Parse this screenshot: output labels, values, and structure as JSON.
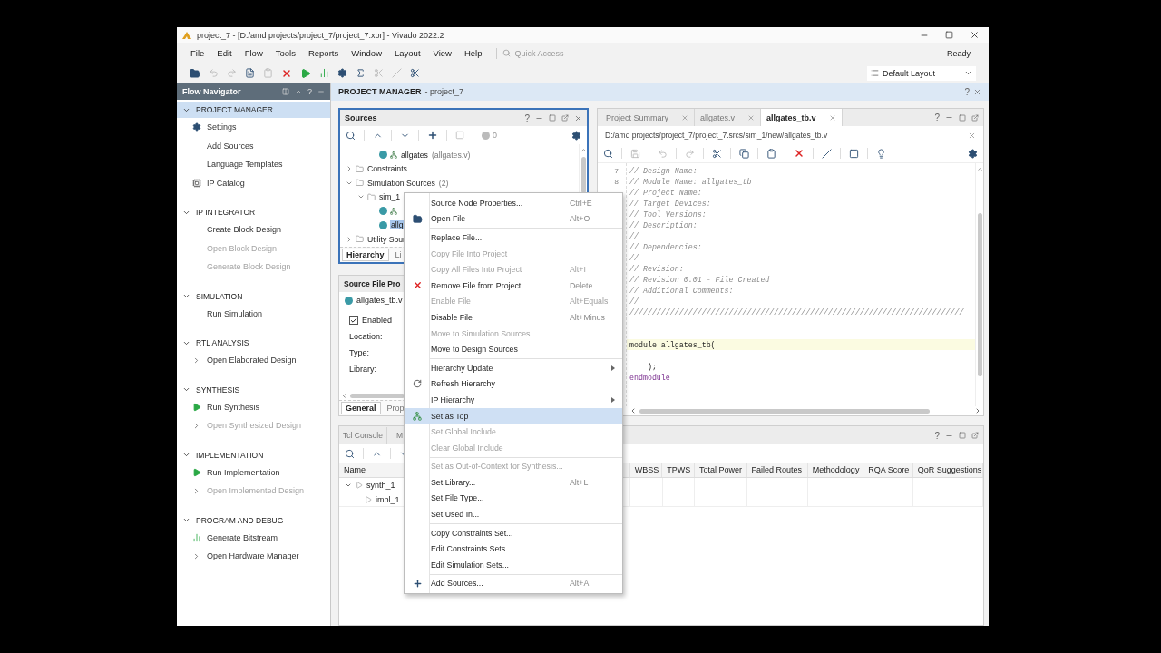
{
  "window": {
    "title": "project_7 - [D:/amd projects/project_7/project_7.xpr] - Vivado 2022.2"
  },
  "menu_bar": [
    "File",
    "Edit",
    "Flow",
    "Tools",
    "Reports",
    "Window",
    "Layout",
    "View",
    "Help"
  ],
  "quick_access": {
    "placeholder": "Quick Access"
  },
  "status": "Ready",
  "layout_select": {
    "value": "Default Layout"
  },
  "flow_navigator": {
    "title": "Flow Navigator",
    "help": "?",
    "sections": [
      {
        "title": "PROJECT MANAGER",
        "selected": true,
        "expanded": true,
        "items": [
          {
            "label": "Settings",
            "kind": "gear",
            "disabled": false
          },
          {
            "label": "Add Sources",
            "kind": "plain",
            "disabled": false
          },
          {
            "label": "Language Templates",
            "kind": "plain",
            "disabled": false
          },
          {
            "label": "IP Catalog",
            "kind": "ip",
            "disabled": false
          }
        ]
      },
      {
        "title": "IP INTEGRATOR",
        "selected": false,
        "expanded": true,
        "items": [
          {
            "label": "Create Block Design",
            "kind": "plain",
            "disabled": false
          },
          {
            "label": "Open Block Design",
            "kind": "plain",
            "disabled": true
          },
          {
            "label": "Generate Block Design",
            "kind": "plain",
            "disabled": true
          }
        ]
      },
      {
        "title": "SIMULATION",
        "selected": false,
        "expanded": true,
        "items": [
          {
            "label": "Run Simulation",
            "kind": "plain",
            "disabled": false
          }
        ]
      },
      {
        "title": "RTL ANALYSIS",
        "selected": false,
        "expanded": true,
        "items": [
          {
            "label": "Open Elaborated Design",
            "kind": "expand",
            "disabled": false
          }
        ]
      },
      {
        "title": "SYNTHESIS",
        "selected": false,
        "expanded": true,
        "items": [
          {
            "label": "Run Synthesis",
            "kind": "play",
            "disabled": false
          },
          {
            "label": "Open Synthesized Design",
            "kind": "expand",
            "disabled": true
          }
        ]
      },
      {
        "title": "IMPLEMENTATION",
        "selected": false,
        "expanded": true,
        "items": [
          {
            "label": "Run Implementation",
            "kind": "play",
            "disabled": false
          },
          {
            "label": "Open Implemented Design",
            "kind": "expand",
            "disabled": true
          }
        ]
      },
      {
        "title": "PROGRAM AND DEBUG",
        "selected": false,
        "expanded": true,
        "items": [
          {
            "label": "Generate Bitstream",
            "kind": "bitstream",
            "disabled": false
          },
          {
            "label": "Open Hardware Manager",
            "kind": "expand",
            "disabled": false
          }
        ]
      }
    ]
  },
  "main_header": {
    "title": "PROJECT MANAGER",
    "subtitle": "- project_7",
    "help": "?"
  },
  "sources": {
    "title": "Sources",
    "help": "?",
    "active": true,
    "badge": "0",
    "scrolled_row": {
      "label": "allgates",
      "detail": "(allgates.v)",
      "kind": "module",
      "selected": false
    },
    "tree": [
      {
        "label": "Constraints",
        "kind": "folder",
        "expanded": false,
        "selected": false
      },
      {
        "label": "Simulation Sources",
        "detail": "(2)",
        "kind": "folder",
        "expanded": true,
        "selected": false,
        "children": [
          {
            "label": "sim_1",
            "kind": "folder",
            "expanded": true,
            "selected": false,
            "children": [
              {
                "kind": "module"
              },
              {
                "label": "allg",
                "kind": "file",
                "selected": true
              }
            ]
          }
        ]
      },
      {
        "label": "Utility Sour",
        "kind": "folder",
        "expanded": false,
        "selected": false
      }
    ],
    "tabs": [
      {
        "label": "Hierarchy",
        "selected": true
      },
      {
        "label": "Li",
        "selected": false
      }
    ]
  },
  "properties": {
    "title": "Source File Pro",
    "file": "allgates_tb.v",
    "enabled": {
      "label": "Enabled",
      "checked": true
    },
    "fields": [
      "Location:",
      "Type:",
      "Library:"
    ],
    "tabs": [
      {
        "label": "General",
        "selected": true
      },
      {
        "label": "Prop",
        "selected": false
      }
    ]
  },
  "editor": {
    "help": "?",
    "tabs": [
      {
        "label": "Project Summary",
        "selected": false
      },
      {
        "label": "allgates.v",
        "selected": false
      },
      {
        "label": "allgates_tb.v",
        "selected": true
      }
    ],
    "path": "D:/amd projects/project_7/project_7.srcs/sim_1/new/allgates_tb.v",
    "lines": [
      {
        "number": "7",
        "kind": "comment",
        "text": "// Design Name:",
        "highlighted": false
      },
      {
        "number": "8",
        "kind": "comment",
        "text": "// Module Name: allgates_tb",
        "highlighted": false
      },
      {
        "kind": "comment",
        "text": "// Project Name:",
        "highlighted": false
      },
      {
        "kind": "comment",
        "text": "// Target Devices:",
        "highlighted": false
      },
      {
        "kind": "comment",
        "text": "// Tool Versions:",
        "highlighted": false
      },
      {
        "kind": "comment",
        "text": "// Description:",
        "highlighted": false
      },
      {
        "kind": "comment",
        "text": "//",
        "highlighted": false
      },
      {
        "kind": "comment",
        "text": "// Dependencies:",
        "highlighted": false
      },
      {
        "kind": "comment",
        "text": "//",
        "highlighted": false
      },
      {
        "kind": "comment",
        "text": "// Revision:",
        "highlighted": false
      },
      {
        "kind": "comment",
        "text": "// Revision 0.01 - File Created",
        "highlighted": false
      },
      {
        "kind": "comment",
        "text": "// Additional Comments:",
        "highlighted": false
      },
      {
        "kind": "comment",
        "text": "//",
        "highlighted": false
      },
      {
        "kind": "comment",
        "text": "//////////////////////////////////////////////////////////////////////////",
        "highlighted": false
      },
      {
        "kind": "blank",
        "highlighted": false
      },
      {
        "kind": "blank",
        "highlighted": false
      },
      {
        "kind": "code",
        "text": "module allgates_tb(",
        "highlighted": true
      },
      {
        "kind": "blank",
        "highlighted": false
      },
      {
        "kind": "code",
        "text": "    );",
        "highlighted": false
      },
      {
        "kind": "keyword",
        "text": "endmodule",
        "highlighted": false
      }
    ]
  },
  "bottom_panel": {
    "help": "?",
    "tabs": [
      "Tcl Console",
      "M"
    ],
    "columns": [
      "Name",
      "WBSS",
      "TPWS",
      "Total Power",
      "Failed Routes",
      "Methodology",
      "RQA Score",
      "QoR Suggestions"
    ],
    "rows": [
      {
        "name": "synth_1",
        "expanded": true,
        "children": [
          {
            "name": "impl_1"
          }
        ]
      }
    ]
  },
  "context_menu": {
    "items": [
      {
        "kind": "plain",
        "label": "Source Node Properties...",
        "shortcut": "Ctrl+E",
        "disabled": false,
        "selected": false
      },
      {
        "kind": "open",
        "label": "Open File",
        "shortcut": "Alt+O",
        "disabled": false,
        "selected": false
      },
      {
        "kind": "separator"
      },
      {
        "kind": "plain",
        "label": "Replace File...",
        "disabled": false,
        "selected": false
      },
      {
        "kind": "plain",
        "label": "Copy File Into Project",
        "disabled": true,
        "selected": false
      },
      {
        "kind": "plain",
        "label": "Copy All Files Into Project",
        "shortcut": "Alt+I",
        "disabled": true,
        "selected": false
      },
      {
        "kind": "remove",
        "label": "Remove File from Project...",
        "shortcut": "Delete",
        "disabled": false,
        "selected": false
      },
      {
        "kind": "plain",
        "label": "Enable File",
        "shortcut": "Alt+Equals",
        "disabled": true,
        "selected": false
      },
      {
        "kind": "plain",
        "label": "Disable File",
        "shortcut": "Alt+Minus",
        "disabled": false,
        "selected": false
      },
      {
        "kind": "plain",
        "label": "Move to Simulation Sources",
        "disabled": true,
        "selected": false
      },
      {
        "kind": "plain",
        "label": "Move to Design Sources",
        "disabled": false,
        "selected": false
      },
      {
        "kind": "separator"
      },
      {
        "kind": "plain",
        "label": "Hierarchy Update",
        "submenu": true,
        "disabled": false,
        "selected": false
      },
      {
        "kind": "refresh",
        "label": "Refresh Hierarchy",
        "disabled": false,
        "selected": false
      },
      {
        "kind": "plain",
        "label": "IP Hierarchy",
        "submenu": true,
        "disabled": false,
        "selected": false
      },
      {
        "kind": "top",
        "label": "Set as Top",
        "disabled": false,
        "selected": true
      },
      {
        "kind": "plain",
        "label": "Set Global Include",
        "disabled": true,
        "selected": false
      },
      {
        "kind": "plain",
        "label": "Clear Global Include",
        "disabled": true,
        "selected": false
      },
      {
        "kind": "separator"
      },
      {
        "kind": "plain",
        "label": "Set as Out-of-Context for Synthesis...",
        "disabled": true,
        "selected": false
      },
      {
        "kind": "plain",
        "label": "Set Library...",
        "shortcut": "Alt+L",
        "disabled": false,
        "selected": false
      },
      {
        "kind": "plain",
        "label": "Set File Type...",
        "disabled": false,
        "selected": false
      },
      {
        "kind": "plain",
        "label": "Set Used In...",
        "disabled": false,
        "selected": false
      },
      {
        "kind": "separator"
      },
      {
        "kind": "plain",
        "label": "Copy Constraints Set...",
        "disabled": false,
        "selected": false
      },
      {
        "kind": "plain",
        "label": "Edit Constraints Sets...",
        "disabled": false,
        "selected": false
      },
      {
        "kind": "plain",
        "label": "Edit Simulation Sets...",
        "disabled": false,
        "selected": false
      },
      {
        "kind": "separator"
      },
      {
        "kind": "add",
        "label": "Add Sources...",
        "shortcut": "Alt+A",
        "disabled": false,
        "selected": false
      }
    ]
  }
}
